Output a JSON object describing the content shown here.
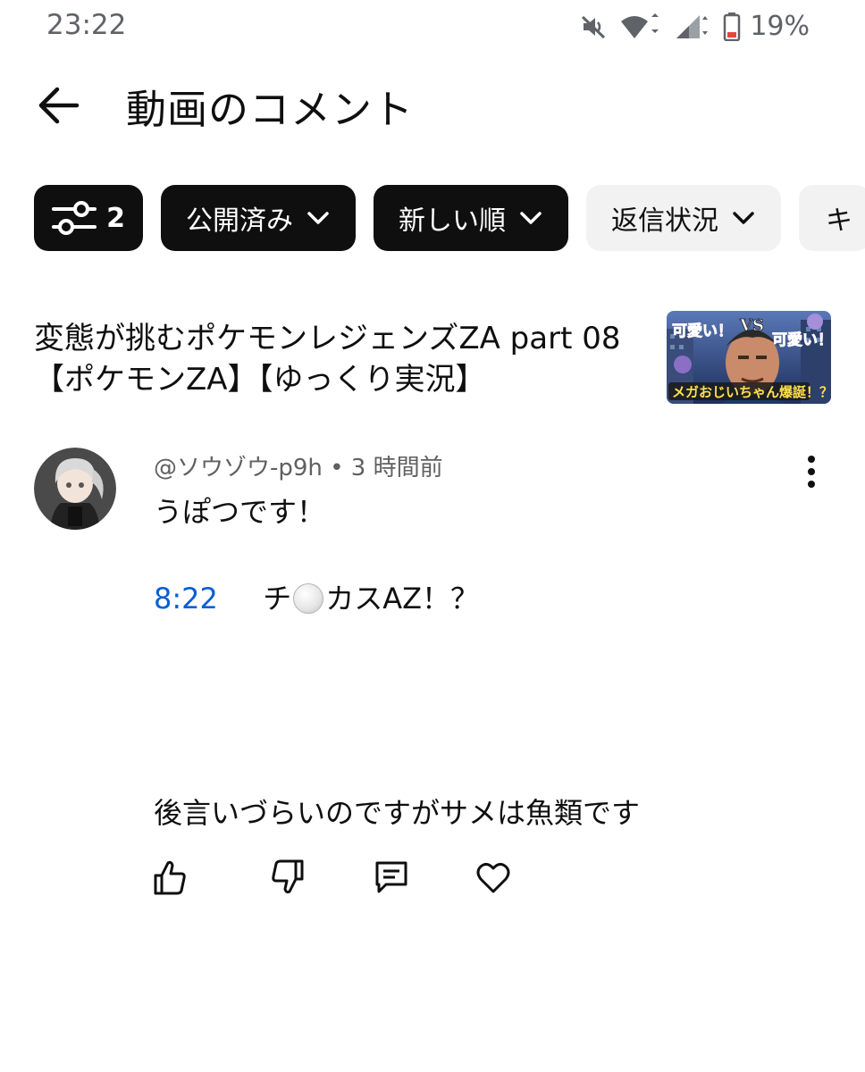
{
  "status_bar": {
    "time": "23:22",
    "battery_percent": "19%",
    "icons": [
      "mute-icon",
      "wifi-icon",
      "signal-icon",
      "battery-icon"
    ]
  },
  "header": {
    "title": "動画のコメント"
  },
  "chips": {
    "filter_count": "2",
    "published": "公開済み",
    "sort": "新しい順",
    "reply_status": "返信状況",
    "partial": "キ"
  },
  "video": {
    "title": "変態が挑むポケモンレジェンズZA part 08 【ポケモンZA】【ゆっくり実況】",
    "thumbnail": {
      "text_left": "可愛い！",
      "text_vs": "VS",
      "text_right": "可愛い！",
      "text_bottom": "メガおじいちゃん爆誕！？"
    }
  },
  "comment": {
    "author": "@ソウゾウ-p9h",
    "separator": "•",
    "time_ago": "3 時間前",
    "line1": "うぽつです！",
    "timestamp": "8:22",
    "line2_before": "チ",
    "line2_after": "カスAZ！？",
    "line3": "後言いづらいのですがサメは魚類です"
  },
  "colors": {
    "chip_dark": "#0f0f0f",
    "chip_light": "#f2f2f2",
    "link": "#065fd4",
    "battery_low": "#e8453c"
  }
}
